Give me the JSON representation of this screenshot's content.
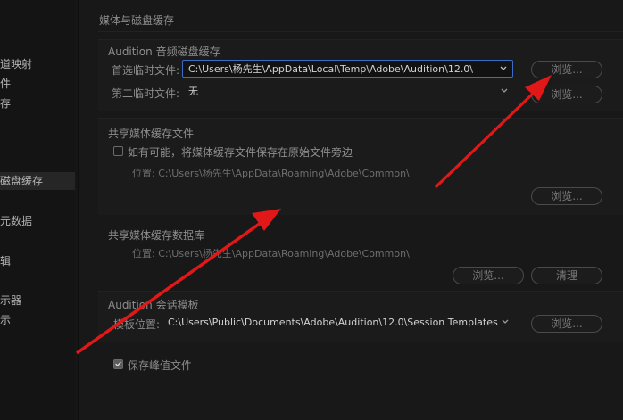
{
  "sidebar": {
    "items": [
      {
        "label": "道映射"
      },
      {
        "label": "件"
      },
      {
        "label": "存"
      },
      {
        "label": "磁盘缓存"
      },
      {
        "label": "元数据"
      },
      {
        "label": "辑"
      },
      {
        "label": "示器"
      },
      {
        "label": "示"
      }
    ]
  },
  "panel": {
    "title": "媒体与磁盘缓存",
    "audition_cache": {
      "heading": "Audition 音频磁盘缓存",
      "primary_label": "首选临时文件:",
      "primary_value": "C:\\Users\\杨先生\\AppData\\Local\\Temp\\Adobe\\Audition\\12.0\\",
      "secondary_label": "第二临时文件:",
      "secondary_value": "无",
      "browse_label": "浏览..."
    },
    "shared_cache_files": {
      "heading": "共享媒体缓存文件",
      "checkbox_label": "如有可能，将媒体缓存文件保存在原始文件旁边",
      "location_text": "位置: C:\\Users\\杨先生\\AppData\\Roaming\\Adobe\\Common\\",
      "browse_label": "浏览..."
    },
    "shared_cache_db": {
      "heading": "共享媒体缓存数据库",
      "location_text": "位置: C:\\Users\\杨先生\\AppData\\Roaming\\Adobe\\Common\\",
      "browse_label": "浏览...",
      "clean_label": "清理"
    },
    "session_template": {
      "heading": "Audition 会话模板",
      "location_label": "模板位置:",
      "location_value": "C:\\Users\\Public\\Documents\\Adobe\\Audition\\12.0\\Session Templates",
      "browse_label": "浏览..."
    },
    "save_peak": {
      "label": "保存峰值文件",
      "checked": true
    }
  },
  "colors": {
    "focus_border": "#3a6ec6",
    "annotation_arrow": "#e01818"
  }
}
